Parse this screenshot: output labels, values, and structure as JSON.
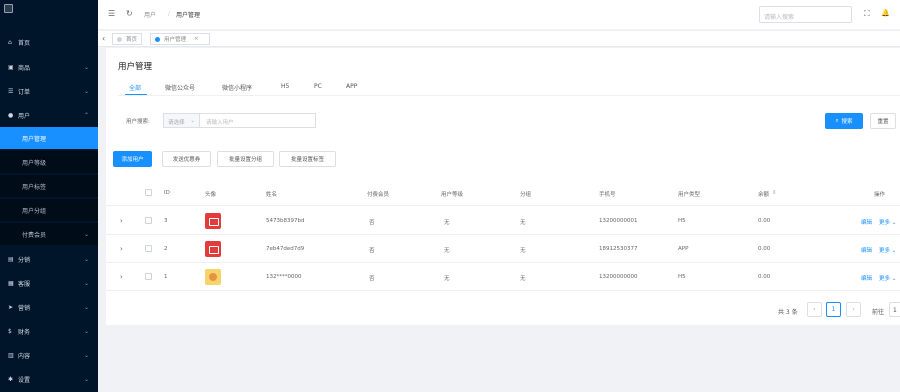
{
  "sidebar": {
    "logo": "logo",
    "items": [
      {
        "icon": "home-icon",
        "glyph": "⌂",
        "label": "首页",
        "chevron": ""
      },
      {
        "icon": "shop-icon",
        "glyph": "▣",
        "label": "商品",
        "chevron": "⌄"
      },
      {
        "icon": "order-icon",
        "glyph": "☰",
        "label": "订单",
        "chevron": "⌄"
      },
      {
        "icon": "user-icon",
        "glyph": "●",
        "label": "用户",
        "chevron": "⌃"
      }
    ],
    "sub_items": [
      {
        "label": "用户管理",
        "active": true
      },
      {
        "label": "用户等级",
        "active": false
      },
      {
        "label": "用户标签",
        "active": false
      },
      {
        "label": "用户分组",
        "active": false
      },
      {
        "label": "付费会员",
        "active": false,
        "chevron": "⌄"
      }
    ],
    "lower_items": [
      {
        "icon": "distribution-icon",
        "glyph": "▤",
        "label": "分销",
        "chevron": "⌄"
      },
      {
        "icon": "customer-icon",
        "glyph": "▦",
        "label": "客服",
        "chevron": "⌄"
      },
      {
        "icon": "marketing-icon",
        "glyph": "➤",
        "label": "营销",
        "chevron": "⌄"
      },
      {
        "icon": "finance-icon",
        "glyph": "$",
        "label": "财务",
        "chevron": "⌄"
      },
      {
        "icon": "content-icon",
        "glyph": "▥",
        "label": "内容",
        "chevron": "⌄"
      },
      {
        "icon": "settings-icon",
        "glyph": "✱",
        "label": "设置",
        "chevron": "⌄"
      }
    ]
  },
  "header": {
    "menu_glyph": "☰",
    "refresh_glyph": "↻",
    "breadcrumb": [
      "用户",
      "用户管理"
    ],
    "search_placeholder": "请输入搜索",
    "fullscreen_glyph": "⛶",
    "bell_glyph": "🔔"
  },
  "tabsbar": {
    "back_glyph": "‹",
    "tabs": [
      {
        "label": "首页",
        "dot_color": "#d0d4da"
      },
      {
        "label": "用户管理",
        "dot_color": "#1890ff",
        "close": "×"
      }
    ]
  },
  "page": {
    "title": "用户管理",
    "filter_tabs": [
      "全部",
      "微信公众号",
      "微信小程序",
      "H5",
      "PC",
      "APP"
    ],
    "search_label": "用户搜索:",
    "select_value": "请选择",
    "select_caret": "⌄",
    "search_input_placeholder": "请输入用户",
    "search_button": "搜索",
    "reset_button": "重置",
    "actions": [
      "添加用户",
      "发送优惠券",
      "批量设置分组",
      "批量设置标签"
    ]
  },
  "table": {
    "columns": [
      "ID",
      "头像",
      "姓名",
      "付费会员",
      "用户等级",
      "分组",
      "手机号",
      "用户类型",
      "余额"
    ],
    "sort_glyph": "⇕",
    "ops_header": "操作",
    "rows": [
      {
        "id": "3",
        "avatar": "red",
        "name": "5473b8397bd",
        "member": "否",
        "level": "无",
        "group": "无",
        "phone": "13200000001",
        "type": "H5",
        "balance": "0.00"
      },
      {
        "id": "2",
        "avatar": "red",
        "name": "7eb47ded7d9",
        "member": "否",
        "level": "无",
        "group": "无",
        "phone": "18912530377",
        "type": "APP",
        "balance": "0.00"
      },
      {
        "id": "1",
        "avatar": "cat",
        "name": "132****0000",
        "member": "否",
        "level": "无",
        "group": "无",
        "phone": "13200000000",
        "type": "H5",
        "balance": "0.00"
      }
    ],
    "edit_label": "编辑",
    "more_label": "更多 ⌄",
    "expand_glyph": "›"
  },
  "pagination": {
    "total": "共 3 条",
    "prev": "‹",
    "current": "1",
    "next": "›",
    "goto_label": "前往",
    "goto_value": "1"
  },
  "colors": {
    "accent": "#1890ff",
    "sidebar_bg": "#001529"
  }
}
